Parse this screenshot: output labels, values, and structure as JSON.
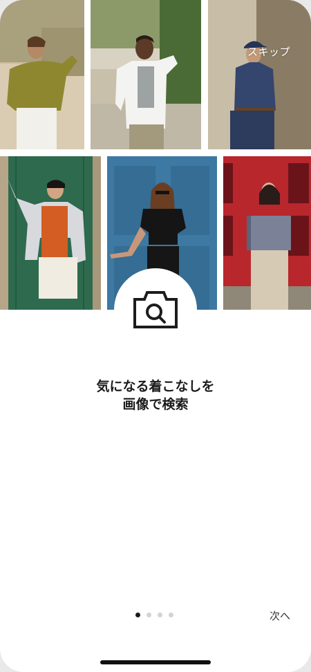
{
  "top_bar": {
    "skip_label": "スキップ"
  },
  "hero": {
    "photos": [
      {
        "name": "photo-woman-olive-shirt",
        "bg": "#d2c3a6"
      },
      {
        "name": "photo-man-white-shirt",
        "bg": "#c9c3b3"
      },
      {
        "name": "photo-man-navy-cap",
        "bg": "#b9ad96"
      },
      {
        "name": "photo-person-green-door",
        "bg": "#2f6b4f"
      },
      {
        "name": "photo-woman-blue-door",
        "bg": "#3c7aa3"
      },
      {
        "name": "photo-woman-red-door",
        "bg": "#b8272c"
      }
    ],
    "camera_icon": "camera-search-icon"
  },
  "headline": {
    "line1": "気になる着こなしを",
    "line2": "画像で検索"
  },
  "pager": {
    "count": 4,
    "active_index": 0
  },
  "footer": {
    "next_label": "次へ"
  },
  "colors": {
    "text": "#1b1b1b",
    "dot_active": "#1a1a1a",
    "dot_inactive": "#d3d3d3"
  }
}
